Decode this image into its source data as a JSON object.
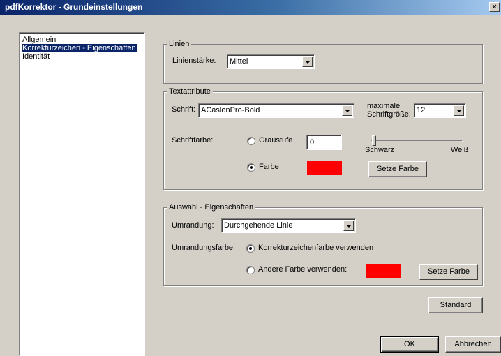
{
  "window": {
    "title": "pdfKorrektor - Grundeinstellungen",
    "close_glyph": "×"
  },
  "sidebar": {
    "items": [
      {
        "label": "Allgemein"
      },
      {
        "label": "Korrekturzeichen - Eigenschaften"
      },
      {
        "label": "Identität"
      }
    ],
    "selected_index": 1
  },
  "linien": {
    "legend": "Linien",
    "linienstaerke_label": "Linienstärke:",
    "linienstaerke_value": "Mittel"
  },
  "textattribute": {
    "legend": "Textattribute",
    "schrift_label": "Schrift:",
    "schrift_value": "ACaslonPro-Bold",
    "max_size_label_line1": "maximale",
    "max_size_label_line2": "Schriftgröße:",
    "max_size_value": "12",
    "schriftfarbe_label": "Schriftfarbe:",
    "graustufe_label": "Graustufe",
    "graustufe_value": "0",
    "slider_left_label": "Schwarz",
    "slider_right_label": "Weiß",
    "slider_value": 0,
    "farbe_label": "Farbe",
    "farbe_color": "#ff0000",
    "setze_farbe_label": "Setze Farbe",
    "selected_mode": "Farbe"
  },
  "auswahl": {
    "legend": "Auswahl - Eigenschaften",
    "umrandung_label": "Umrandung:",
    "umrandung_value": "Durchgehende Linie",
    "umrandungsfarbe_label": "Umrandungsfarbe:",
    "option_korrektur_label": "Korrekturzeichenfarbe verwenden",
    "option_andere_label": "Andere Farbe verwenden:",
    "andere_color": "#ff0000",
    "setze_farbe_label": "Setze Farbe",
    "selected_option": "Korrekturzeichenfarbe verwenden"
  },
  "buttons": {
    "standard_label": "Standard",
    "ok_label": "OK",
    "abbrechen_label": "Abbrechen"
  },
  "colors": {
    "title_bar": "#0a246a",
    "face": "#d4d0c8",
    "selection": "#0a246a",
    "accent_red": "#ff0000"
  }
}
